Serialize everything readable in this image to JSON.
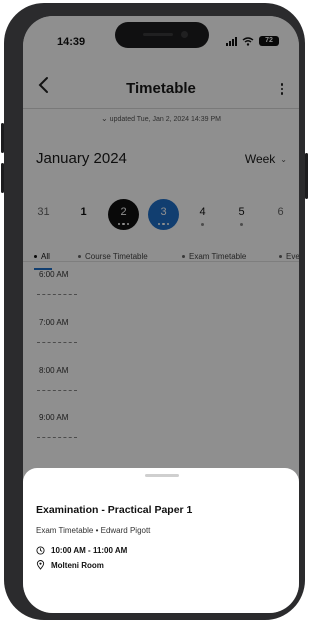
{
  "status_bar": {
    "time": "14:39",
    "battery": "72"
  },
  "header": {
    "title": "Timetable",
    "updated": "updated Tue, Jan 2, 2024 14:39 PM"
  },
  "calendar": {
    "month": "January 2024",
    "view": "Week",
    "days": [
      {
        "label": "31",
        "state": "muted"
      },
      {
        "label": "1",
        "state": "normal"
      },
      {
        "label": "2",
        "state": "selected"
      },
      {
        "label": "3",
        "state": "today"
      },
      {
        "label": "4",
        "state": "normal"
      },
      {
        "label": "5",
        "state": "normal"
      },
      {
        "label": "6",
        "state": "muted"
      }
    ]
  },
  "filters": [
    "All",
    "Course Timetable",
    "Exam Timetable",
    "Eve"
  ],
  "timeline": {
    "hours": [
      "6:00 AM",
      "7:00 AM",
      "8:00 AM",
      "9:00 AM"
    ]
  },
  "event": {
    "title": "Examination - Practical Paper 1",
    "subtitle": "Exam Timetable • Edward Pigott",
    "time": "10:00 AM - 11:00 AM",
    "location": "Molteni Room"
  },
  "icons": {
    "back": "arrow-left-icon",
    "more": "more-vertical-icon",
    "time": "clock-icon",
    "location": "map-pin-icon"
  },
  "colors": {
    "accent": "#1f6fc8",
    "selected": "#111111"
  }
}
